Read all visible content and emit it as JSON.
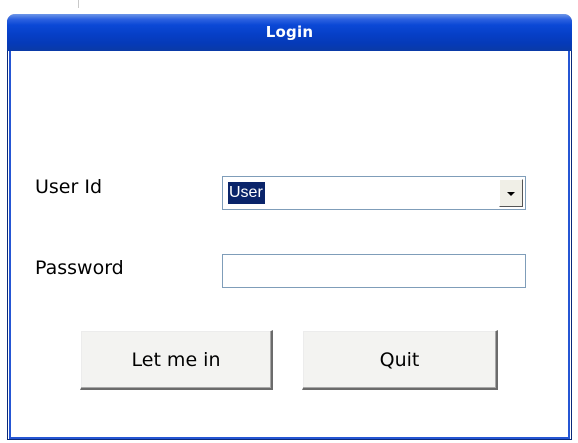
{
  "window": {
    "title": "Login"
  },
  "form": {
    "user_id_label": "User Id",
    "user_id_value": "User",
    "password_label": "Password",
    "password_value": ""
  },
  "buttons": {
    "let_me_in": "Let me in",
    "quit": "Quit"
  },
  "colors": {
    "titlebar": "#0b48d6",
    "selection": "#0a246a",
    "field_border": "#7f9db9"
  },
  "icons": {
    "dropdown": "chevron-down-icon"
  }
}
